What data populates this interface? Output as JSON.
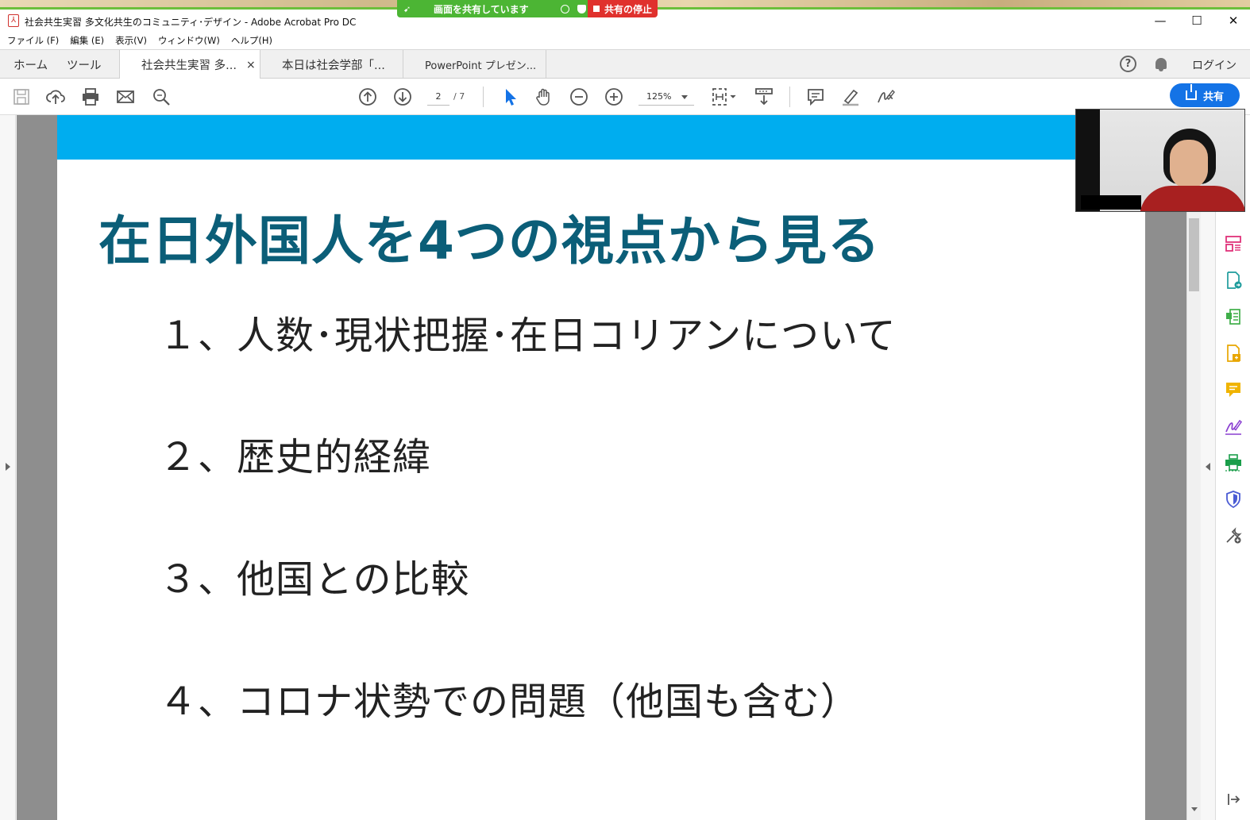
{
  "window": {
    "title": "社会共生実習 多文化共生のコミュニティ･デザイン - Adobe Acrobat Pro DC",
    "minimize": "—",
    "maximize": "☐",
    "close": "✕"
  },
  "share_banner": {
    "sharing_label": "画面を共有しています",
    "stop_label": "共有の停止"
  },
  "menu": [
    "ファイル (F)",
    "編集 (E)",
    "表示(V)",
    "ウィンドウ(W)",
    "ヘルプ(H)"
  ],
  "tabs": {
    "home": "ホーム",
    "tools": "ツール",
    "docs": [
      {
        "label": "社会共生実習 多...",
        "close": "×",
        "active": true
      },
      {
        "label": "本日は社会学部「...",
        "active": false
      },
      {
        "label": "PowerPoint プレゼン...",
        "active": false
      }
    ],
    "help": "?",
    "login": "ログイン"
  },
  "toolbar": {
    "page_current": "2",
    "page_total": "/ 7",
    "zoom": "125%",
    "share_label": "共有"
  },
  "slide": {
    "title": "在日外国人を4つの視点から見る",
    "items": [
      "１、人数･現状把握･在日コリアンについて",
      "２、歴史的経緯",
      "３、他国との比較",
      "４、コロナ状勢での問題（他国も含む）"
    ]
  },
  "colors": {
    "band": "#00adef",
    "title": "#0b5e78",
    "share_button": "#1473e6",
    "banner_green": "#4cb534",
    "banner_red": "#e0312d"
  },
  "icons": {
    "toolbar": [
      "save-icon",
      "upload-icon",
      "print-icon",
      "mail-icon",
      "search-icon",
      "page-up-icon",
      "page-down-icon",
      "select-arrow-icon",
      "hand-icon",
      "zoom-out-icon",
      "zoom-in-icon",
      "fit-page-icon",
      "scroll-mode-icon",
      "comment-icon",
      "highlight-icon",
      "sign-icon"
    ],
    "right_panel": [
      "organize-pages-icon",
      "export-pdf-icon",
      "edit-pdf-icon",
      "create-pdf-icon",
      "comment-tool-icon",
      "fill-sign-icon",
      "print-production-icon",
      "protect-icon",
      "more-tools-icon",
      "collapse-panel-icon"
    ]
  }
}
